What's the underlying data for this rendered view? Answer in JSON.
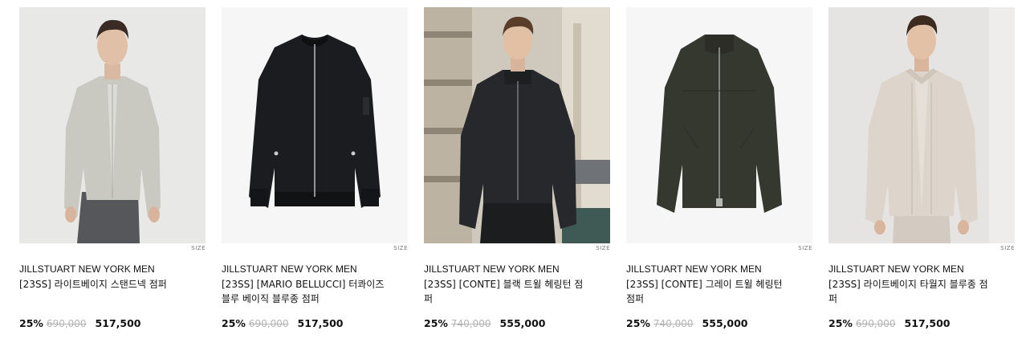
{
  "products": [
    {
      "brand": "JILLSTUART NEW YORK MEN",
      "name": "[23SS] 라이트베이지 스탠드넥 점퍼",
      "discount": "25%",
      "original_price": "690,000",
      "sale_price": "517,500",
      "size_tag": "SIZE",
      "image": "model-beige-standneck-jacket"
    },
    {
      "brand": "JILLSTUART NEW YORK MEN",
      "name": "[23SS] [MARIO BELLUCCI] 터콰이즈블루 베이직 블루종 점퍼",
      "discount": "25%",
      "original_price": "690,000",
      "sale_price": "517,500",
      "size_tag": "SIZE",
      "image": "black-bomber-jacket-flatlay"
    },
    {
      "brand": "JILLSTUART NEW YORK MEN",
      "name": "[23SS] [CONTE] 블랙 트윌 헤링턴 점퍼",
      "discount": "25%",
      "original_price": "740,000",
      "sale_price": "555,000",
      "size_tag": "SIZE",
      "image": "model-black-harrington-street"
    },
    {
      "brand": "JILLSTUART NEW YORK MEN",
      "name": "[23SS] [CONTE] 그레이 트윌 헤링턴 점퍼",
      "discount": "25%",
      "original_price": "740,000",
      "sale_price": "555,000",
      "size_tag": "SIZE",
      "image": "gray-harrington-jacket-flatlay"
    },
    {
      "brand": "JILLSTUART NEW YORK MEN",
      "name": "[23SS] 라이트베이지 타월지 블루종 점퍼",
      "discount": "25%",
      "original_price": "690,000",
      "sale_price": "517,500",
      "size_tag": "SIZE",
      "image": "model-beige-towel-blouson"
    }
  ]
}
